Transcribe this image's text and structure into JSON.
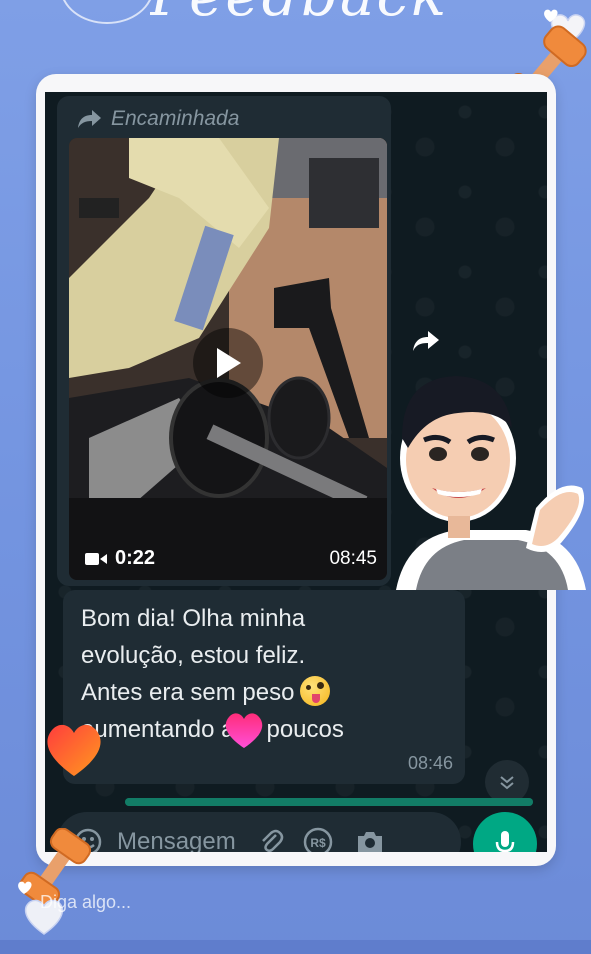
{
  "story": {
    "title_partial": "Feedback",
    "reply_placeholder": "Diga algo..."
  },
  "forwarded": {
    "label": "Encaminhada",
    "video": {
      "duration": "0:22",
      "time": "08:45",
      "play_icon": "play-icon",
      "camera_icon": "video-camera-icon"
    }
  },
  "message": {
    "lines": [
      "Bom dia! Olha minha",
      "evolução, estou feliz.",
      "Antes era sem peso",
      "aumentando aos poucos"
    ],
    "emoji": "zany-face-emoji",
    "time": "08:46"
  },
  "composer": {
    "placeholder": "Mensagem",
    "icons": [
      "emoji-icon",
      "attach-icon",
      "currency-icon",
      "camera-icon",
      "mic-icon"
    ],
    "currency_label": "R$",
    "progress": 1.0
  },
  "colors": {
    "background": "#7f9fe6",
    "chat_background": "#0f1b21",
    "bubble": "#1f2c34",
    "accent_green": "#00a884",
    "meta_text": "#8696a0",
    "dumbbell": "#f08a3c"
  },
  "stickers": [
    "dumbbell-sticker",
    "heart-sticker",
    "hearts-sticker",
    "avatar-sticker"
  ]
}
